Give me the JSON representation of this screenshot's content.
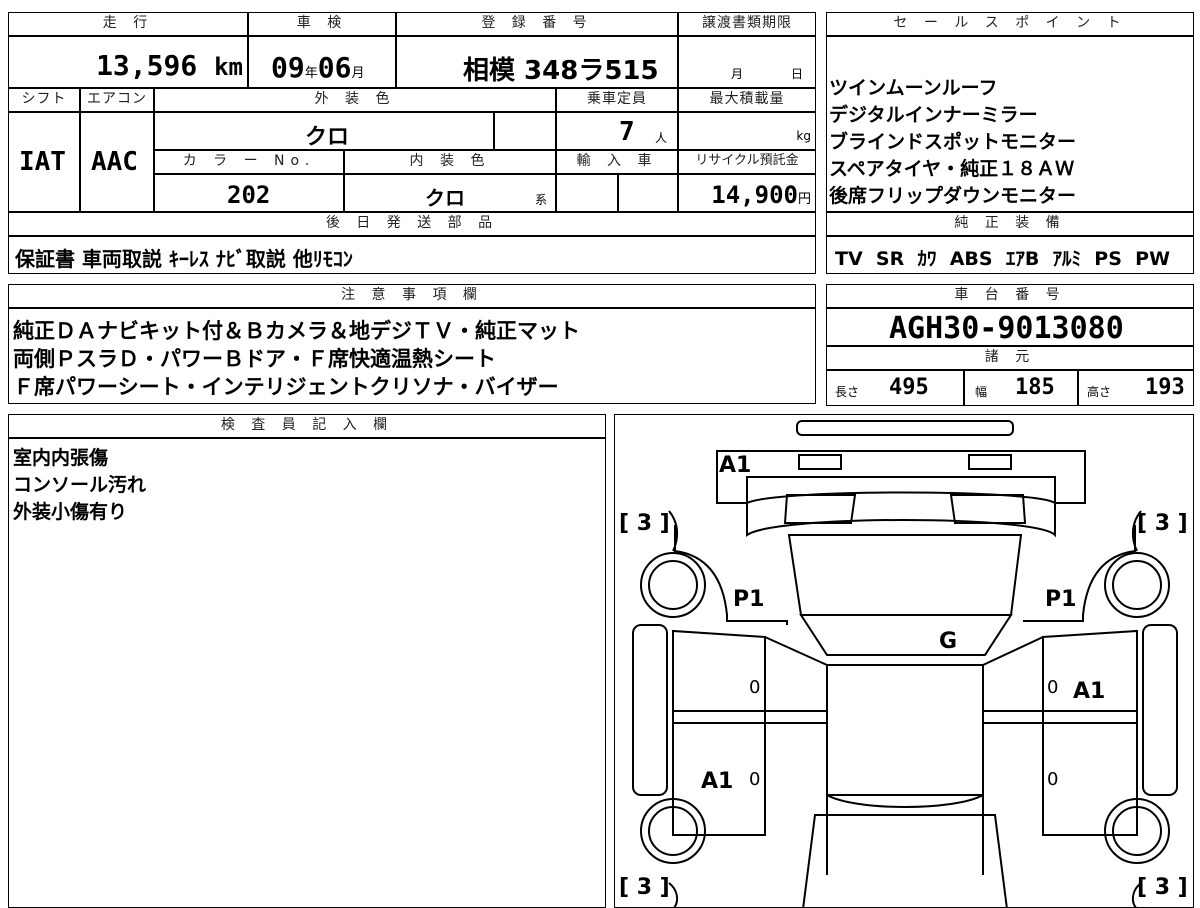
{
  "top": {
    "mileage_label": "走 行",
    "mileage_value": "13,596",
    "mileage_unit": "km",
    "inspection_label": "車 検",
    "inspection_year": "09",
    "inspection_year_unit": "年",
    "inspection_month": "06",
    "inspection_month_unit": "月",
    "registration_label": "登 録 番 号",
    "registration_value": "相模 348ラ515",
    "transfer_label": "譲渡書類期限",
    "transfer_month": "月",
    "transfer_day": "日",
    "shift_label": "シフト",
    "shift_value": "IAT",
    "ac_label": "エアコン",
    "ac_value": "AAC",
    "exterior_label": "外 装 色",
    "exterior_value": "クロ",
    "capacity_label": "乗車定員",
    "capacity_value": "7",
    "capacity_unit": "人",
    "load_label": "最大積載量",
    "load_unit": "kg",
    "color_no_label": "カ ラ ー No.",
    "color_no_value": "202",
    "interior_label": "内 装 色",
    "interior_value": "クロ",
    "interior_unit": "系",
    "import_label": "輸 入 車",
    "recycle_label": "リサイクル預託金",
    "recycle_value": "14,900",
    "recycle_unit": "円"
  },
  "sales": {
    "label": "セ ー ル ス ポ イ ン ト",
    "points": [
      "ツインムーンルーフ",
      "デジタルインナーミラー",
      "ブラインドスポットモニター",
      "スペアタイヤ・純正１８ＡＷ",
      "後席フリップダウンモニター"
    ]
  },
  "parts": {
    "label": "後 日 発 送 部 品",
    "value": "保証書 車両取説 ｷｰﾚｽ ﾅﾋﾞ取説 他ﾘﾓｺﾝ"
  },
  "equipment": {
    "label": "純 正 装 備",
    "items": [
      "TV",
      "SR",
      "ｶﾜ",
      "ABS",
      "ｴｱB",
      "ｱﾙﾐ",
      "PS",
      "PW"
    ]
  },
  "notes": {
    "label": "注 意 事 項 欄",
    "lines": [
      "純正ＤＡナビキット付＆Ｂカメラ＆地デジＴＶ・純正マット",
      "両側ＰスラＤ・パワーＢドア・Ｆ席快適温熱シート",
      "Ｆ席パワーシート・インテリジェントクリソナ・バイザー"
    ]
  },
  "chassis": {
    "label": "車 台 番 号",
    "value": "AGH30-9013080"
  },
  "specs": {
    "label": "諸 元",
    "length_label": "長さ",
    "length_value": "495",
    "width_label": "幅",
    "width_value": "185",
    "height_label": "高さ",
    "height_value": "193"
  },
  "inspector": {
    "label": "検 査 員 記 入 欄",
    "lines": [
      "室内内張傷",
      "コンソール汚れ",
      "外装小傷有り"
    ]
  },
  "diagram": {
    "marks": {
      "front": "A1",
      "left_front_fender": "P1",
      "right_front_fender": "P1",
      "windshield": "G",
      "right_rear_door": "A1",
      "left_rear_quarter": "A1",
      "tire_fl": "[ 3 ]",
      "tire_fr": "[ 3 ]",
      "tire_rl": "[ 3 ]",
      "tire_rr": "[ 3 ]",
      "zero_1": "0",
      "zero_2": "0",
      "zero_3": "0",
      "zero_4": "0"
    }
  }
}
